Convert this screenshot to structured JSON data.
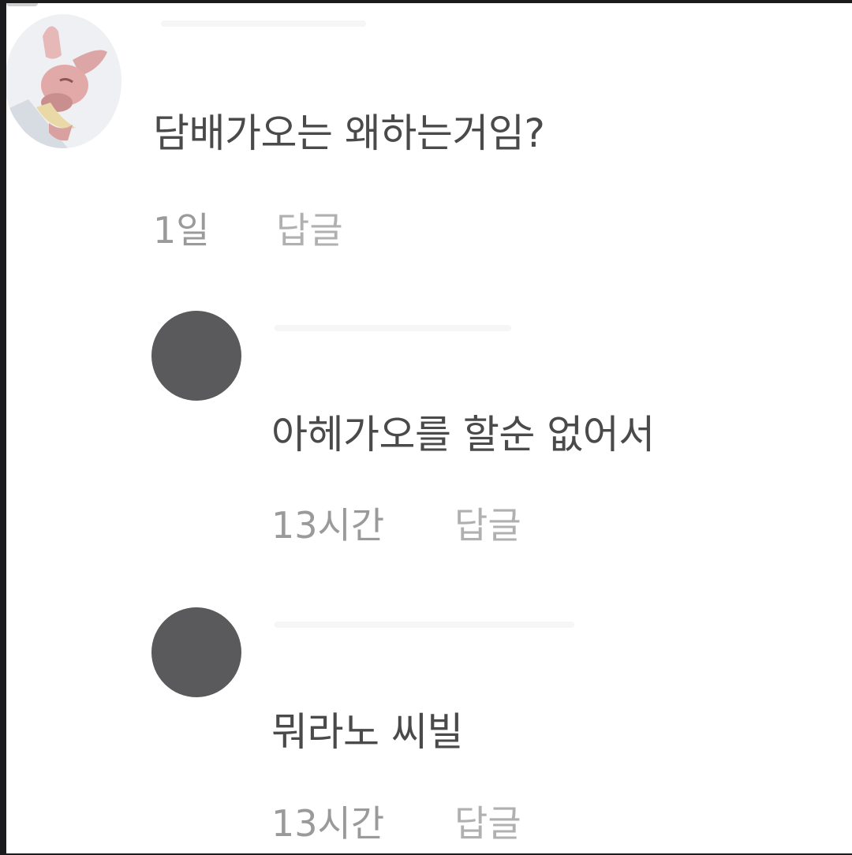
{
  "comments": [
    {
      "text": "담배가오는 왜하는거임?",
      "time": "1일",
      "reply": "답글"
    },
    {
      "text": "아헤가오를 할순 없어서",
      "time": "13시간",
      "reply": "답글"
    },
    {
      "text": "뭐라노 씨빌",
      "time": "13시간",
      "reply": "답글"
    }
  ],
  "colors": {
    "background": "#ffffff",
    "comment_text": "#4a4a4a",
    "meta_text": "#9a9a9a",
    "avatar_placeholder": "#5a5a5c"
  }
}
